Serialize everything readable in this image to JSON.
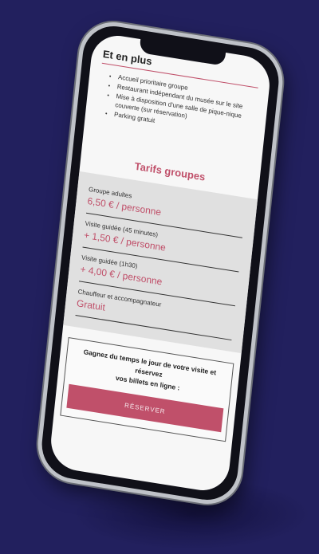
{
  "extras": {
    "title": "Et en plus",
    "items": [
      "Accueil prioritaire groupe",
      "Restaurant indépendant du musée sur le site",
      "Mise à disposition d'une salle de pique-nique couverte (sur réservation)",
      "Parking gratuit"
    ]
  },
  "pricing": {
    "title": "Tarifs groupes",
    "rows": [
      {
        "label": "Groupe adultes",
        "value": "6,50 € / personne"
      },
      {
        "label": "Visite guidée (45 minutes)",
        "value": "+ 1,50 € / personne"
      },
      {
        "label": "Visite guidée (1h30)",
        "value": "+ 4,00 € / personne"
      },
      {
        "label": "Chauffeur et accompagnateur",
        "value": "Gratuit"
      }
    ]
  },
  "booking": {
    "text_line1": "Gagnez du temps le jour de votre visite et réservez",
    "text_line2": "vos billets en ligne :",
    "button_label": "RÉSERVER"
  },
  "colors": {
    "background": "#22205e",
    "accent": "#c0506a"
  }
}
